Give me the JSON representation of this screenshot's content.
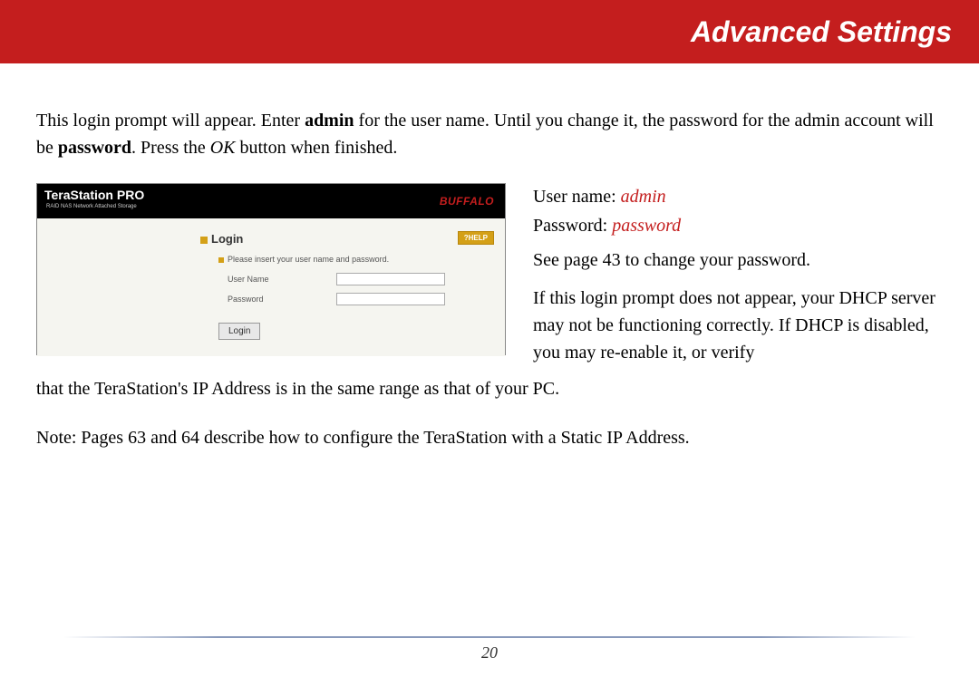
{
  "header": {
    "title": "Advanced Settings"
  },
  "intro": {
    "p1a": "This login prompt will appear.  Enter ",
    "p1b": "admin",
    "p1c": " for the user name.  Until you change it, the password for the admin account will be ",
    "p1d": "password",
    "p1e": ".    Press the ",
    "p1f": "OK",
    "p1g": " button when finished."
  },
  "screenshot": {
    "logo": "TeraStation PRO",
    "logo_sub": "RAID NAS Network Attached Storage",
    "brand": "BUFFALO",
    "login_heading": "Login",
    "help": "?HELP",
    "instruct": "Please insert your user name and password.",
    "user_label": "User Name",
    "pass_label": "Password",
    "login_btn": "Login"
  },
  "right": {
    "user_label": "User name:  ",
    "user_val": "admin",
    "pass_label": "Password:  ",
    "pass_val": "password",
    "see_page": "See page 43 to change your password.",
    "dhcp1": "If this login prompt does not appear, your DHCP server may not be functioning correctly.  If DHCP is disabled, you may re-enable it, or verify"
  },
  "wrap": "that the TeraStation's IP Address is in the same range as that of your PC.",
  "note": "Note:  Pages 63 and 64 describe how to configure the TeraStation with a Static IP Address.",
  "page_num": "20"
}
